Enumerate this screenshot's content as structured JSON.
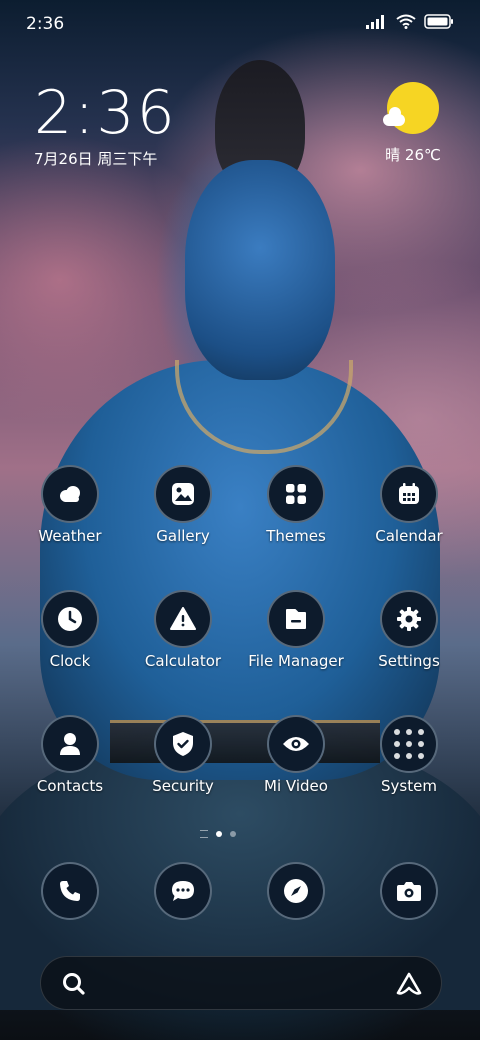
{
  "status_bar": {
    "time": "2:36",
    "icons": [
      "signal-icon",
      "wifi-icon",
      "battery-icon"
    ]
  },
  "clock_widget": {
    "time": "2:36",
    "date": "7月26日 周三下午"
  },
  "weather_widget": {
    "condition": "晴",
    "temperature": "26℃",
    "icon": "sun-cloud-icon"
  },
  "apps": [
    {
      "label": "Weather",
      "icon": "cloud-icon"
    },
    {
      "label": "Gallery",
      "icon": "image-icon"
    },
    {
      "label": "Themes",
      "icon": "grid-icon"
    },
    {
      "label": "Calendar",
      "icon": "calendar-icon"
    },
    {
      "label": "Clock",
      "icon": "clock-icon"
    },
    {
      "label": "Calculator",
      "icon": "warning-icon"
    },
    {
      "label": "File Manager",
      "icon": "folder-icon"
    },
    {
      "label": "Settings",
      "icon": "gear-icon"
    },
    {
      "label": "Contacts",
      "icon": "person-icon"
    },
    {
      "label": "Security",
      "icon": "shield-icon"
    },
    {
      "label": "Mi Video",
      "icon": "eye-icon"
    },
    {
      "label": "System",
      "icon": "folder-grid-icon"
    }
  ],
  "page_indicator": {
    "pages": 2,
    "current": 1
  },
  "dock": [
    {
      "icon": "phone-icon"
    },
    {
      "icon": "chat-icon"
    },
    {
      "icon": "compass-icon"
    },
    {
      "icon": "camera-icon"
    }
  ],
  "search_bar": {
    "left_icon": "search-icon",
    "right_icon": "assistant-icon"
  },
  "colors": {
    "icon_bg": "#0d1b2c",
    "sun": "#f6d523"
  }
}
